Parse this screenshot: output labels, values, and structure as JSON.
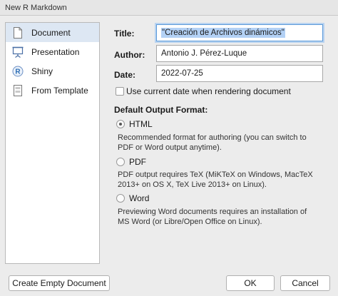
{
  "window": {
    "title": "New R Markdown"
  },
  "sidebar": {
    "items": [
      {
        "label": "Document",
        "icon": "document-icon",
        "selected": true
      },
      {
        "label": "Presentation",
        "icon": "presentation-icon",
        "selected": false
      },
      {
        "label": "Shiny",
        "icon": "shiny-r-icon",
        "selected": false
      },
      {
        "label": "From Template",
        "icon": "template-icon",
        "selected": false
      }
    ]
  },
  "form": {
    "title_label": "Title:",
    "title_value": "\"Creación de Archivos dinámicos\"",
    "author_label": "Author:",
    "author_value": "Antonio J. Pérez-Luque",
    "date_label": "Date:",
    "date_value": "2022-07-25",
    "use_current_date_label": "Use current date when rendering document",
    "use_current_date_checked": false
  },
  "output": {
    "section_label": "Default Output Format:",
    "selected": "HTML",
    "options": [
      {
        "label": "HTML",
        "description_lines": [
          "Recommended format for authoring (you can switch to",
          "PDF or Word output anytime)."
        ]
      },
      {
        "label": "PDF",
        "description_lines": [
          "PDF output requires TeX (MiKTeX on Windows, MacTeX",
          "2013+ on OS X, TeX Live 2013+ on Linux)."
        ]
      },
      {
        "label": "Word",
        "description_lines": [
          "Previewing Word documents requires an installation of",
          "MS Word (or Libre/Open Office on Linux)."
        ]
      }
    ]
  },
  "buttons": {
    "create_empty": "Create Empty Document",
    "ok": "OK",
    "cancel": "Cancel"
  },
  "colors": {
    "selection_bg": "#dde7f3",
    "focus_ring": "#5b9ad9",
    "text_selection": "#b3d1f5"
  }
}
